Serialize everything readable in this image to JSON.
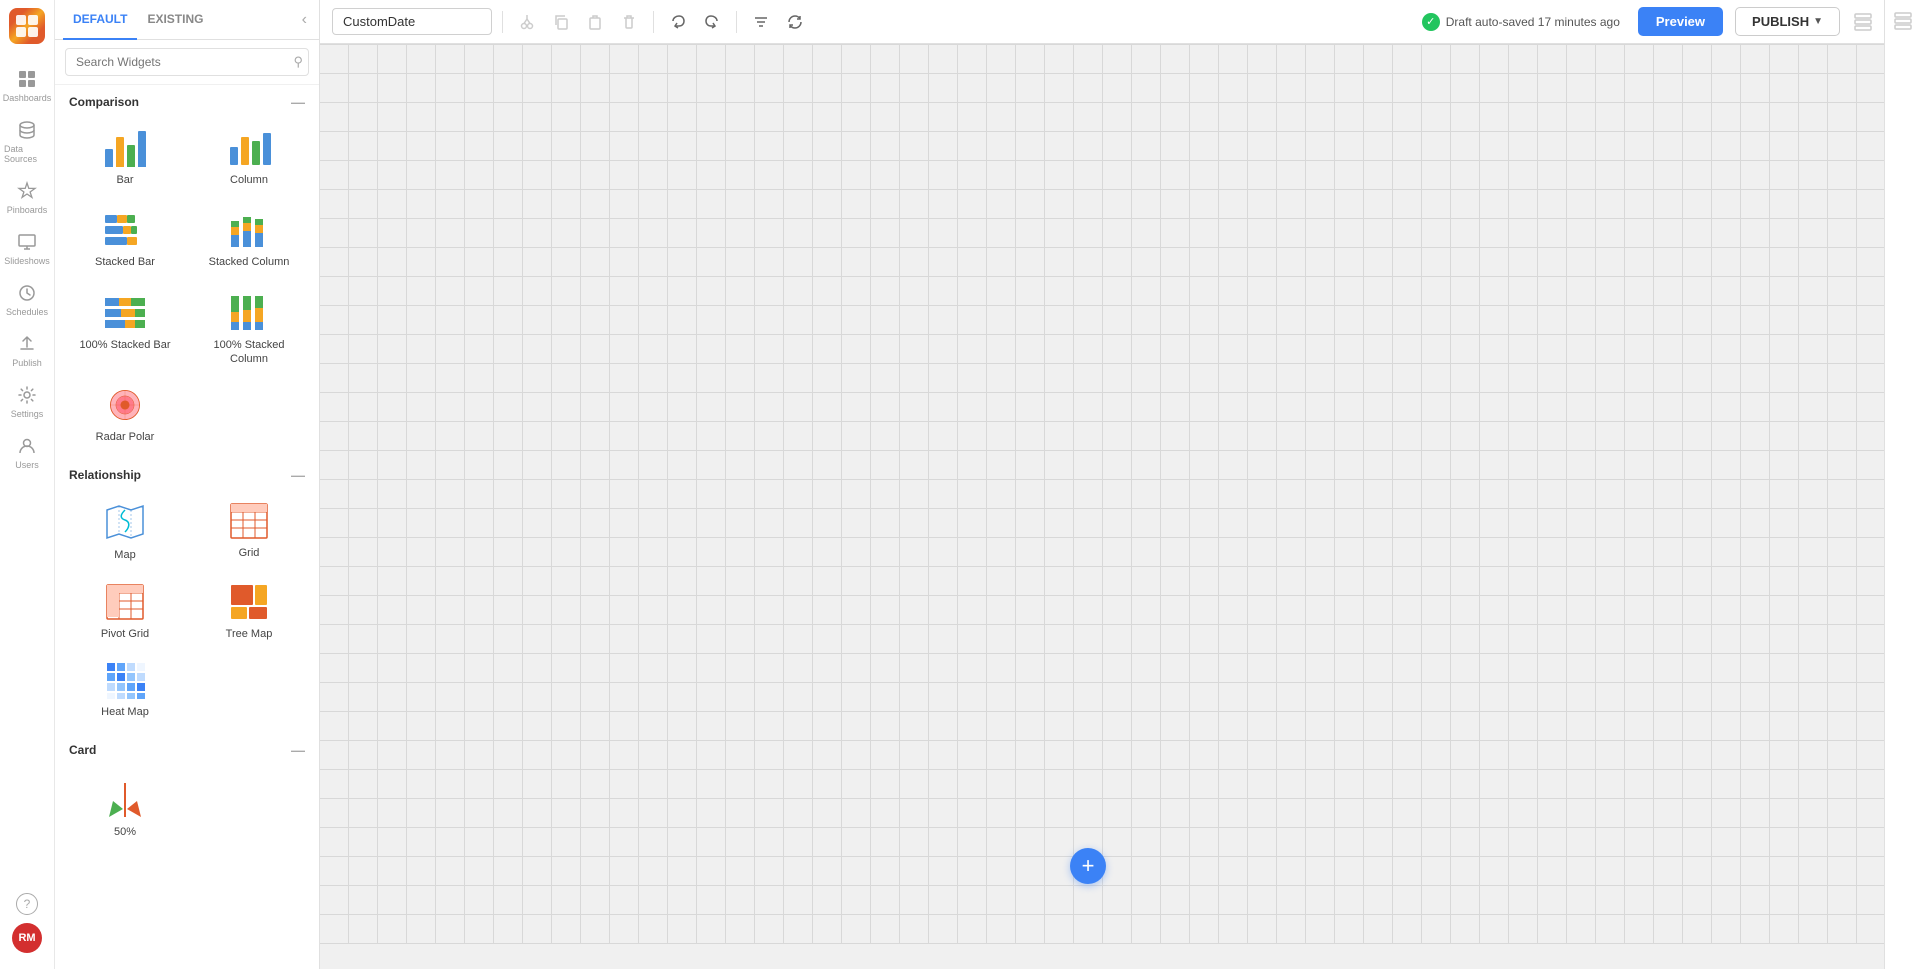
{
  "app": {
    "title": "CustomDate",
    "logo_text": "RM"
  },
  "toolbar": {
    "title_value": "CustomDate",
    "autosave_text": "Draft auto-saved 17 minutes ago",
    "preview_label": "Preview",
    "publish_label": "PUBLISH"
  },
  "nav": {
    "items": [
      {
        "id": "dashboards",
        "label": "Dashboards"
      },
      {
        "id": "data-sources",
        "label": "Data Sources"
      },
      {
        "id": "pinboards",
        "label": "Pinboards"
      },
      {
        "id": "slideshows",
        "label": "Slideshows"
      },
      {
        "id": "schedules",
        "label": "Schedules"
      },
      {
        "id": "publish",
        "label": "Publish"
      },
      {
        "id": "settings",
        "label": "Settings"
      },
      {
        "id": "users",
        "label": "Users"
      }
    ]
  },
  "widgets_panel": {
    "tab_default": "DEFAULT",
    "tab_existing": "EXISTING",
    "search_placeholder": "Search Widgets",
    "sections": [
      {
        "id": "comparison",
        "label": "Comparison",
        "widgets": [
          {
            "id": "bar",
            "label": "Bar"
          },
          {
            "id": "column",
            "label": "Column"
          },
          {
            "id": "stacked-bar",
            "label": "Stacked Bar"
          },
          {
            "id": "stacked-column",
            "label": "Stacked Column"
          },
          {
            "id": "100pct-stacked-bar",
            "label": "100% Stacked Bar"
          },
          {
            "id": "100pct-stacked-column",
            "label": "100% Stacked Column"
          },
          {
            "id": "radar-polar",
            "label": "Radar Polar"
          }
        ]
      },
      {
        "id": "relationship",
        "label": "Relationship",
        "widgets": [
          {
            "id": "map",
            "label": "Map"
          },
          {
            "id": "grid",
            "label": "Grid"
          },
          {
            "id": "pivot-grid",
            "label": "Pivot Grid"
          },
          {
            "id": "tree-map",
            "label": "Tree Map"
          },
          {
            "id": "heat-map",
            "label": "Heat Map"
          }
        ]
      },
      {
        "id": "card",
        "label": "Card",
        "widgets": []
      }
    ]
  },
  "colors": {
    "blue_accent": "#3b82f6",
    "orange": "#e05a2b",
    "green": "#22c55e",
    "red": "#ef4444",
    "bar_blue": "#4a90d9",
    "bar_orange": "#f5a623",
    "bar_green": "#4caf50",
    "bar_red": "#e05a2b"
  }
}
